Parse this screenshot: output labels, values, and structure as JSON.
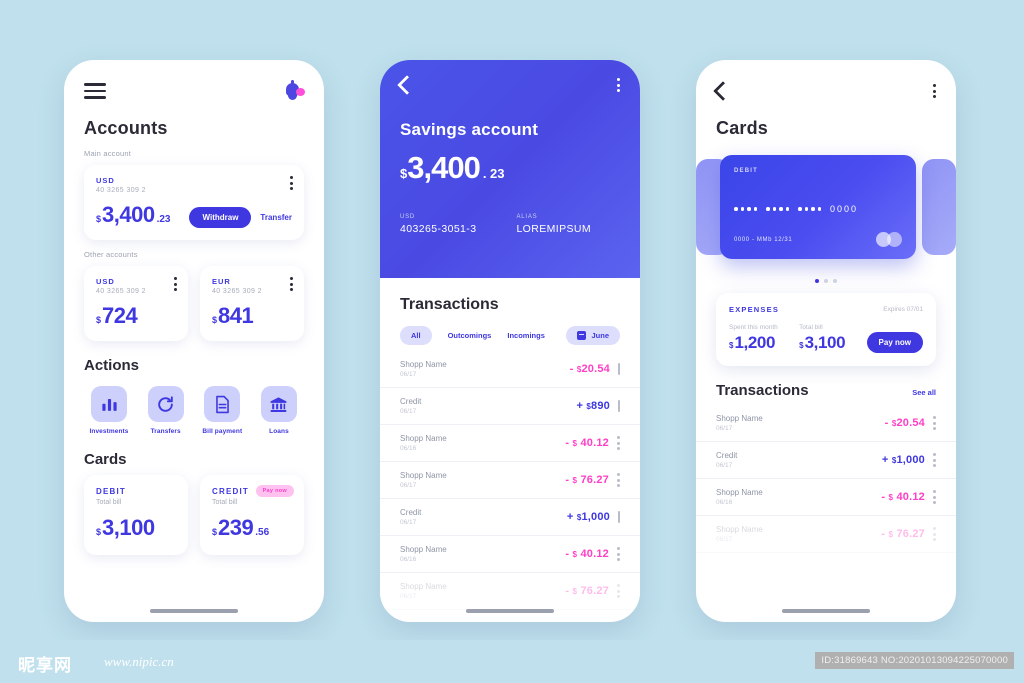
{
  "screen1": {
    "menu_icon": "hamburger-icon",
    "bell_icon": "notification-bell-icon",
    "title": "Accounts",
    "main_label": "Main account",
    "main_account": {
      "currency": "USD",
      "number": "40 3265 309 2",
      "symbol": "$",
      "amount": "3,400",
      "cents": ".23",
      "withdraw_label": "Withdraw",
      "transfer_label": "Transfer"
    },
    "other_label": "Other accounts",
    "other_accounts": [
      {
        "currency": "USD",
        "number": "40 3265 309 2",
        "symbol": "$",
        "amount": "724"
      },
      {
        "currency": "EUR",
        "number": "40 3265 309 2",
        "symbol": "$",
        "amount": "841"
      }
    ],
    "actions_title": "Actions",
    "actions": [
      {
        "label": "Investments",
        "icon": "bar-chart-icon"
      },
      {
        "label": "Transfers",
        "icon": "refresh-arrow-icon"
      },
      {
        "label": "Bill payment",
        "icon": "document-icon"
      },
      {
        "label": "Loans",
        "icon": "bank-building-icon"
      }
    ],
    "cards_title": "Cards",
    "cards": [
      {
        "type": "DEBIT",
        "sub": "Total bill",
        "symbol": "$",
        "amount": "3,100",
        "cents": "",
        "badge": ""
      },
      {
        "type": "CREDIT",
        "sub": "Total bill",
        "symbol": "$",
        "amount": "239",
        "cents": ".56",
        "badge": "Pay now"
      }
    ]
  },
  "screen2": {
    "back_icon": "back-chevron-icon",
    "kebab_icon": "more-options-icon",
    "hero": {
      "title": "Savings account",
      "symbol": "$",
      "amount": "3,400",
      "cents": ". 23",
      "currency_key": "USD",
      "currency_value": "403265-3051-3",
      "alias_key": "ALIAS",
      "alias_value": "LOREMIPSUM"
    },
    "transactions_title": "Transactions",
    "filters": [
      "All",
      "Outcomings",
      "Incomings"
    ],
    "active_filter": "All",
    "date_chip": "June",
    "calendar_icon": "calendar-icon",
    "transactions": [
      {
        "name": "Shopp Name",
        "date": "06/17",
        "sign": "-",
        "currency": "$",
        "amount": "20.54",
        "type": "neg",
        "menu": "bar"
      },
      {
        "name": "Credit",
        "date": "06/17",
        "sign": "+",
        "currency": "$",
        "amount": "890",
        "type": "pos",
        "menu": "bar"
      },
      {
        "name": "Shopp Name",
        "date": "06/16",
        "sign": "-",
        "currency": "$",
        "amount": "40.12",
        "type": "neg",
        "menu": "dots"
      },
      {
        "name": "Shopp Name",
        "date": "06/17",
        "sign": "-",
        "currency": "$",
        "amount": "76.27",
        "type": "neg",
        "menu": "dots"
      },
      {
        "name": "Credit",
        "date": "06/17",
        "sign": "+",
        "currency": "$",
        "amount": "1,000",
        "type": "pos",
        "menu": "bar"
      },
      {
        "name": "Shopp Name",
        "date": "06/16",
        "sign": "-",
        "currency": "$",
        "amount": "40.12",
        "type": "neg",
        "menu": "dots"
      },
      {
        "name": "Shopp Name",
        "date": "06/17",
        "sign": "-",
        "currency": "$",
        "amount": "76.27",
        "type": "neg",
        "menu": "dots"
      }
    ]
  },
  "screen3": {
    "back_icon": "back-chevron-icon",
    "kebab_icon": "more-options-icon",
    "title": "Cards",
    "card": {
      "type": "DEBIT",
      "masked_groups": [
        "••••",
        "••••",
        "••••"
      ],
      "last4": "0000",
      "footer": "0000 - MMb  12/31",
      "brand_icon": "mastercard-logo-icon"
    },
    "carousel_dots": 3,
    "active_dot": 0,
    "expenses": {
      "title": "EXPENSES",
      "expiry": "Expires 07/01",
      "spent_label": "Spent this month",
      "spent_symbol": "$",
      "spent_value": "1,200",
      "total_label": "Total bill",
      "total_symbol": "$",
      "total_value": "3,100",
      "pay_label": "Pay now"
    },
    "transactions_title": "Transactions",
    "see_all": "See all",
    "transactions": [
      {
        "name": "Shopp Name",
        "date": "06/17",
        "sign": "-",
        "currency": "$",
        "amount": "20.54",
        "type": "neg"
      },
      {
        "name": "Credit",
        "date": "06/17",
        "sign": "+",
        "currency": "$",
        "amount": "1,000",
        "type": "pos"
      },
      {
        "name": "Shopp Name",
        "date": "06/16",
        "sign": "-",
        "currency": "$",
        "amount": "40.12",
        "type": "neg"
      },
      {
        "name": "Shopp Name",
        "date": "06/17",
        "sign": "-",
        "currency": "$",
        "amount": "76.27",
        "type": "neg"
      }
    ]
  },
  "watermark": {
    "logo": "昵享网",
    "url": "www.nipic.cn",
    "id": "ID:31869643 NO:20201013094225070000"
  },
  "colors": {
    "background": "#bfe0ec",
    "accent": "#3f37e0",
    "accent_pink": "#ff3fc6",
    "card_gradient_start": "#3a45e8",
    "card_gradient_end": "#6a6ef8"
  }
}
